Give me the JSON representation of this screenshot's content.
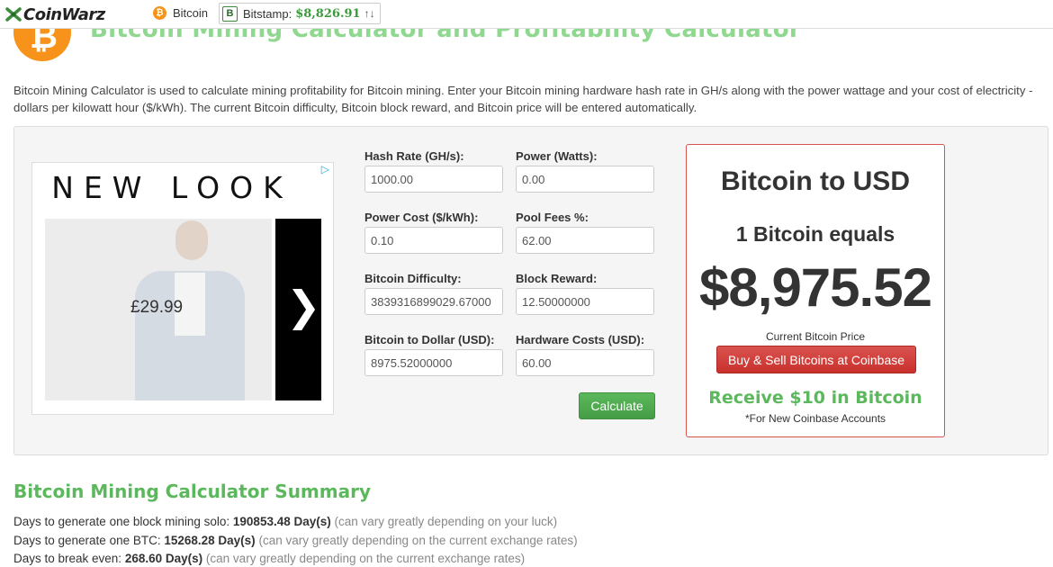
{
  "nav": {
    "logo_text": "CoinWarz",
    "btc_link": "Bitcoin",
    "btc_symbol": "₿",
    "bitstamp_label": "Bitstamp:",
    "bitstamp_price": "$8,826.91",
    "bitstamp_arrows": "↑↓",
    "bitstamp_icon": "B"
  },
  "header": {
    "coin_symbol": "₿",
    "title": "Bitcoin Mining Calculator and Profitability Calculator",
    "intro": "Bitcoin Mining Calculator is used to calculate mining profitability for Bitcoin mining. Enter your Bitcoin mining hardware hash rate in GH/s along with the power wattage and your cost of electricity - dollars per kilowatt hour ($/kWh). The current Bitcoin difficulty, Bitcoin block reward, and Bitcoin price will be entered automatically."
  },
  "ad": {
    "brand": "NEW LOOK",
    "price": "£29.99",
    "arrow": "❯",
    "choices_icon": "▷"
  },
  "form": {
    "hash_rate": {
      "label": "Hash Rate (GH/s):",
      "value": "1000.00"
    },
    "power": {
      "label": "Power (Watts):",
      "value": "0.00"
    },
    "power_cost": {
      "label": "Power Cost ($/kWh):",
      "value": "0.10"
    },
    "pool_fees": {
      "label": "Pool Fees %:",
      "value": "62.00"
    },
    "difficulty": {
      "label": "Bitcoin Difficulty:",
      "value": "3839316899029.67000"
    },
    "block_reward": {
      "label": "Block Reward:",
      "value": "12.50000000"
    },
    "btc_to_usd": {
      "label": "Bitcoin to Dollar (USD):",
      "value": "8975.52000000"
    },
    "hardware_costs": {
      "label": "Hardware Costs (USD):",
      "value": "60.00"
    },
    "calculate_label": "Calculate"
  },
  "price_box": {
    "title": "Bitcoin to USD",
    "equals": "1 Bitcoin equals",
    "price": "$8,975.52",
    "caption": "Current Bitcoin Price",
    "button": "Buy & Sell Bitcoins at Coinbase",
    "promo": "Receive $10 in Bitcoin",
    "note": "*For New Coinbase Accounts"
  },
  "summary": {
    "title": "Bitcoin Mining Calculator Summary",
    "lines": [
      {
        "label": "Days to generate one block mining solo:",
        "value": "190853.48 Day(s)",
        "note": "(can vary greatly depending on your luck)"
      },
      {
        "label": "Days to generate one BTC:",
        "value": "15268.28 Day(s)",
        "note": "(can vary greatly depending on the current exchange rates)"
      },
      {
        "label": "Days to break even:",
        "value": "268.60 Day(s)",
        "note": "(can vary greatly depending on the current exchange rates)"
      }
    ]
  },
  "colors": {
    "accent_green": "#5cb85c",
    "title_green": "#8fd88f",
    "bitcoin_orange": "#f7931a",
    "coinbase_red": "#d9534f"
  }
}
